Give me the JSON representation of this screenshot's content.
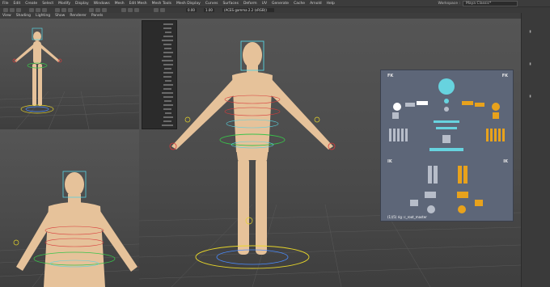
{
  "menubar": {
    "items": [
      "File",
      "Edit",
      "Create",
      "Select",
      "Modify",
      "Display",
      "Windows",
      "Mesh",
      "Edit Mesh",
      "Mesh Tools",
      "Mesh Display",
      "Curves",
      "Surfaces",
      "Deform",
      "UV",
      "Generate",
      "Cache",
      "Arnold",
      "Help"
    ],
    "workspace_label": "Workspace :",
    "workspace_value": "Maya Classic*"
  },
  "toolbar": {
    "field1": "0.00",
    "field2": "1.00",
    "camera": "(ACES gamma 2.2 (sRGB))"
  },
  "panel_menu": {
    "items": [
      "View",
      "Shading",
      "Lighting",
      "Show",
      "Renderer",
      "Panels"
    ]
  },
  "picker": {
    "fk_left": "FK",
    "fk_right": "FK",
    "ik_left": "IK",
    "ik_right": "IK",
    "status": "(1)(5) rig :c_root_master",
    "colors": {
      "bg": "#5d6678",
      "cyan": "#67d3df",
      "orange": "#e8a21c",
      "white": "#ffffff",
      "grey": "#b7bdc9"
    }
  },
  "viewport_colors": {
    "skin": "#e6c29a",
    "control_red": "#d83a3a",
    "control_blue": "#4a8cff",
    "control_yellow": "#e6d52a",
    "control_green": "#39c34a",
    "control_cyan": "#57d3e0"
  }
}
